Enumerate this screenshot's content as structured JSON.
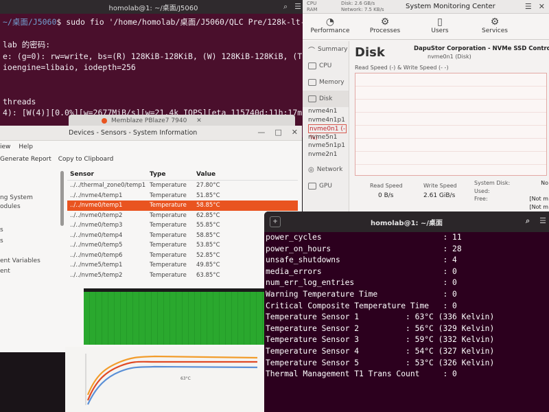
{
  "terminal_back": {
    "title": "homolab@1: ~/桌面/J5060",
    "prompt_path": "~/桌面/J5060",
    "command": "$ sudo fio '/home/homolab/桌面/J5060/QLC Pre/128k-lt-reall",
    "lines": [
      "",
      "lab 的密码:",
      "e: (g=0): rw=write, bs=(R) 128KiB-128KiB, (W) 128KiB-128KiB, (T) 128K",
      "ioengine=libaio, iodepth=256",
      "",
      "",
      "threads",
      "4): [W(4)][0.0%][w=2677MiB/s][w=21.4k IOPS][eta 115740d:11h:17m:28s]"
    ]
  },
  "smc": {
    "title": "System Monitoring Center",
    "mini_cpu": "CPU",
    "mini_ram": "RAM",
    "mini_disk": "Disk:",
    "mini_disk_val": "2.6 GB/s",
    "mini_net": "Network:",
    "mini_net_val": "7.5 KB/s",
    "tabs": [
      "Performance",
      "Processes",
      "Users",
      "Services"
    ],
    "side": [
      "Summary",
      "CPU",
      "Memory",
      "Disk",
      "Network",
      "GPU"
    ],
    "disks": [
      "nvme4n1",
      "nvme4n1p1",
      "nvme0n1 (-%)",
      "nvme5n1",
      "nvme5n1p1",
      "nvme2n1"
    ],
    "heading": "Disk",
    "device": "DapuStor Corporation - NVMe SSD Controller DP6",
    "device_sub": "nvme0n1 (Disk)",
    "rw_label": "Read Speed (-) & Write Speed (- -)",
    "read_label": "Read Speed",
    "write_label": "Write Speed",
    "read_val": "0 B/s",
    "write_val": "2.61 GiB/s",
    "sys_disk_label": "System Disk:",
    "sys_disk_val": "No",
    "used_label": "Used:",
    "free_label": "Free:",
    "free_val": "[Not m",
    "used_val": "[Not m"
  },
  "memblaze_tab": "Memblaze PBlaze7 7940",
  "sensors": {
    "title": "Devices - Sensors - System Information",
    "menu": [
      "iew",
      "Help"
    ],
    "toolbar": [
      "Generate Report",
      "Copy to Clipboard"
    ],
    "nav": [
      "ng System",
      "odules",
      "s",
      "s",
      "ent Variables",
      "ent"
    ],
    "columns": [
      "Sensor",
      "Type",
      "Value"
    ],
    "rows": [
      [
        "../../thermal_zone0/temp1",
        "Temperature",
        "27.80°C"
      ],
      [
        "../../nvme4/temp1",
        "Temperature",
        "51.85°C"
      ],
      [
        "../../nvme0/temp1",
        "Temperature",
        "58.85°C"
      ],
      [
        "../../nvme0/temp2",
        "Temperature",
        "62.85°C"
      ],
      [
        "../../nvme0/temp3",
        "Temperature",
        "55.85°C"
      ],
      [
        "../../nvme0/temp4",
        "Temperature",
        "58.85°C"
      ],
      [
        "../../nvme0/temp5",
        "Temperature",
        "53.85°C"
      ],
      [
        "../../nvme0/temp6",
        "Temperature",
        "52.85°C"
      ],
      [
        "../../nvme5/temp1",
        "Temperature",
        "49.85°C"
      ],
      [
        "../../nvme5/temp2",
        "Temperature",
        "63.85°C"
      ]
    ],
    "selected_index": 2
  },
  "terminal_front": {
    "title": "homolab@1: ~/桌面",
    "lines": [
      [
        "power_cycles",
        "                          : 11"
      ],
      [
        "power_on_hours",
        "                        : 28"
      ],
      [
        "unsafe_shutdowns",
        "                      : 4"
      ],
      [
        "media_errors",
        "                          : 0"
      ],
      [
        "num_err_log_entries",
        "                   : 0"
      ],
      [
        "Warning Temperature Time",
        "              : 0"
      ],
      [
        "Critical Composite Temperature Time",
        "   : 0"
      ],
      [
        "Temperature Sensor 1",
        "          : 63°C (336 Kelvin)"
      ],
      [
        "Temperature Sensor 2",
        "          : 56°C (329 Kelvin)"
      ],
      [
        "Temperature Sensor 3",
        "          : 59°C (332 Kelvin)"
      ],
      [
        "Temperature Sensor 4",
        "          : 54°C (327 Kelvin)"
      ],
      [
        "Temperature Sensor 5",
        "          : 53°C (326 Kelvin)"
      ],
      [
        "Thermal Management T1 Trans Count",
        "     : 0"
      ]
    ]
  },
  "colors": {
    "terminal_bg": "#2c001e",
    "accent": "#e95420",
    "green": "#2aa82e"
  }
}
